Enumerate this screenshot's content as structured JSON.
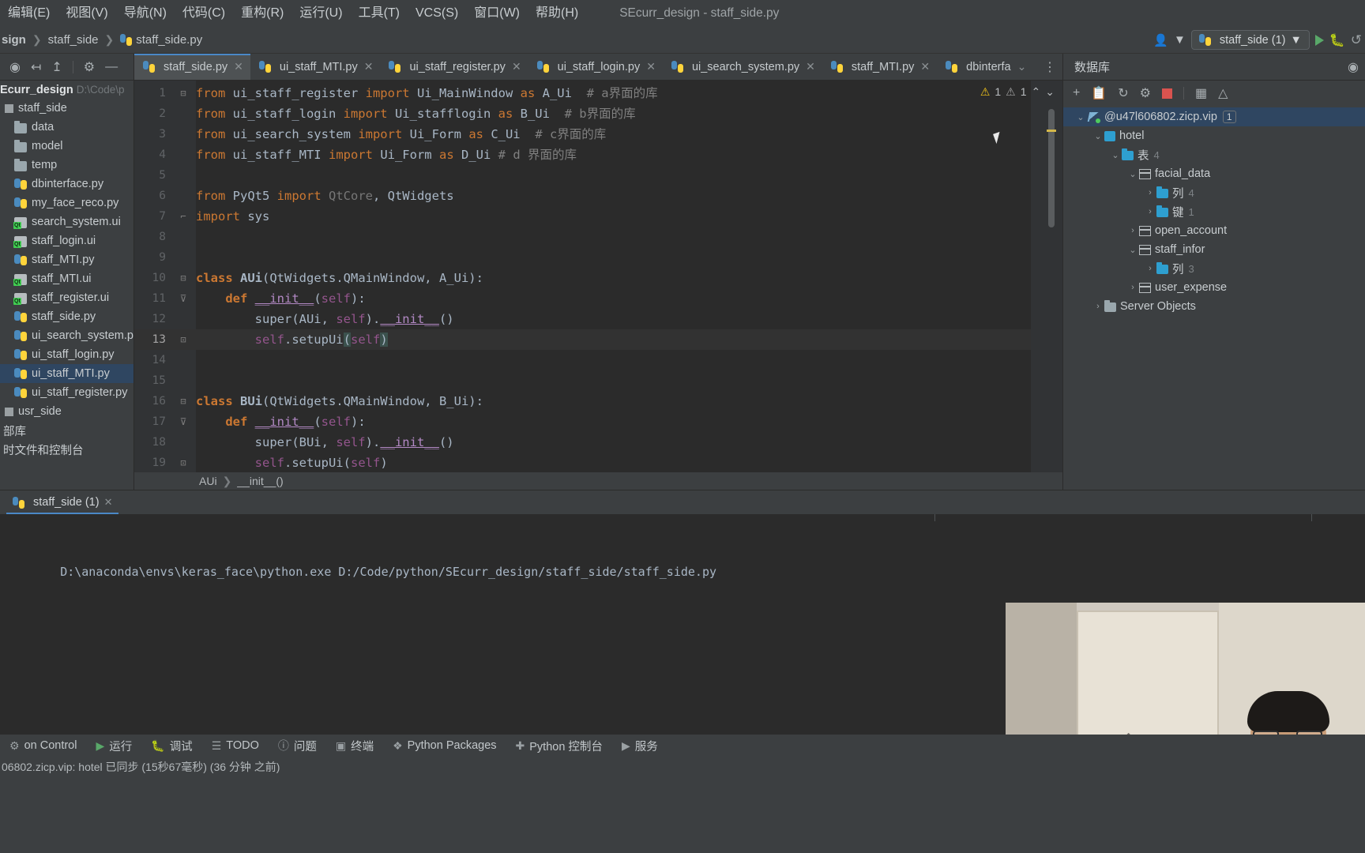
{
  "window": {
    "title": "SEcurr_design - staff_side.py"
  },
  "menubar": {
    "items": [
      {
        "label": "编辑(E)"
      },
      {
        "label": "视图(V)"
      },
      {
        "label": "导航(N)"
      },
      {
        "label": "代码(C)"
      },
      {
        "label": "重构(R)"
      },
      {
        "label": "运行(U)"
      },
      {
        "label": "工具(T)"
      },
      {
        "label": "VCS(S)"
      },
      {
        "label": "窗口(W)"
      },
      {
        "label": "帮助(H)"
      }
    ]
  },
  "navbar": {
    "breadcrumbs": [
      "sign",
      "staff_side",
      "staff_side.py"
    ],
    "run_config": "staff_side (1)",
    "run_config_caret": "▼",
    "user_caret": "▼"
  },
  "project": {
    "header_name": "Ecurr_design",
    "header_path": "D:\\Code\\p",
    "tree": [
      {
        "label": "staff_side",
        "icon": "module-icon",
        "indent": 0,
        "selected": false
      },
      {
        "label": "data",
        "icon": "folder-icon",
        "indent": 1,
        "selected": false
      },
      {
        "label": "model",
        "icon": "folder-icon",
        "indent": 1,
        "selected": false
      },
      {
        "label": "temp",
        "icon": "folder-icon",
        "indent": 1,
        "selected": false
      },
      {
        "label": "dbinterface.py",
        "icon": "python-file-icon",
        "indent": 1,
        "selected": false
      },
      {
        "label": "my_face_reco.py",
        "icon": "python-file-icon",
        "indent": 1,
        "selected": false
      },
      {
        "label": "search_system.ui",
        "icon": "qt-file-icon",
        "indent": 1,
        "selected": false
      },
      {
        "label": "staff_login.ui",
        "icon": "qt-file-icon",
        "indent": 1,
        "selected": false
      },
      {
        "label": "staff_MTI.py",
        "icon": "python-file-icon",
        "indent": 1,
        "selected": false
      },
      {
        "label": "staff_MTI.ui",
        "icon": "qt-file-icon",
        "indent": 1,
        "selected": false
      },
      {
        "label": "staff_register.ui",
        "icon": "qt-file-icon",
        "indent": 1,
        "selected": false
      },
      {
        "label": "staff_side.py",
        "icon": "python-file-icon",
        "indent": 1,
        "selected": false
      },
      {
        "label": "ui_search_system.py",
        "icon": "python-file-icon",
        "indent": 1,
        "selected": false
      },
      {
        "label": "ui_staff_login.py",
        "icon": "python-file-icon",
        "indent": 1,
        "selected": false
      },
      {
        "label": "ui_staff_MTI.py",
        "icon": "python-file-icon",
        "indent": 1,
        "selected": true
      },
      {
        "label": "ui_staff_register.py",
        "icon": "python-file-icon",
        "indent": 1,
        "selected": false
      },
      {
        "label": "usr_side",
        "icon": "module-icon",
        "indent": 0,
        "selected": false
      },
      {
        "label": "部库",
        "icon": "none",
        "indent": 0,
        "selected": false
      },
      {
        "label": "时文件和控制台",
        "icon": "none",
        "indent": 0,
        "selected": false
      }
    ]
  },
  "editor": {
    "tabs": [
      {
        "label": "staff_side.py",
        "active": true
      },
      {
        "label": "ui_staff_MTI.py",
        "active": false
      },
      {
        "label": "ui_staff_register.py",
        "active": false
      },
      {
        "label": "ui_staff_login.py",
        "active": false
      },
      {
        "label": "ui_search_system.py",
        "active": false
      },
      {
        "label": "staff_MTI.py",
        "active": false
      },
      {
        "label": "dbinterfa",
        "active": false
      }
    ],
    "inspection": {
      "warning_count": "1",
      "weak_warning_count": "1",
      "up_caret": "⌃",
      "down_caret": "⌄"
    },
    "lines": [
      {
        "n": "1",
        "fold": "⊟"
      },
      {
        "n": "2",
        "fold": ""
      },
      {
        "n": "3",
        "fold": ""
      },
      {
        "n": "4",
        "fold": ""
      },
      {
        "n": "5",
        "fold": ""
      },
      {
        "n": "6",
        "fold": ""
      },
      {
        "n": "7",
        "fold": "⌐"
      },
      {
        "n": "8",
        "fold": ""
      },
      {
        "n": "9",
        "fold": ""
      },
      {
        "n": "10",
        "fold": "⊟"
      },
      {
        "n": "11",
        "fold": "⊽"
      },
      {
        "n": "12",
        "fold": ""
      },
      {
        "n": "13",
        "fold": "⊡"
      },
      {
        "n": "14",
        "fold": ""
      },
      {
        "n": "15",
        "fold": ""
      },
      {
        "n": "16",
        "fold": "⊟"
      },
      {
        "n": "17",
        "fold": "⊽"
      },
      {
        "n": "18",
        "fold": ""
      },
      {
        "n": "19",
        "fold": "⊡"
      }
    ],
    "code_text": [
      "from ui_staff_register import Ui_MainWindow as A_Ui  # a界面的库",
      "from ui_staff_login import Ui_stafflogin as B_Ui  # b界面的库",
      "from ui_search_system import Ui_Form as C_Ui  # c界面的库",
      "from ui_staff_MTI import Ui_Form as D_Ui  # d 界面的库",
      "",
      "from PyQt5 import QtCore, QtWidgets",
      "import sys",
      "",
      "",
      "class AUi(QtWidgets.QMainWindow, A_Ui):",
      "    def __init__(self):",
      "        super(AUi, self).__init__()",
      "        self.setupUi(self)",
      "",
      "",
      "class BUi(QtWidgets.QMainWindow, B_Ui):",
      "    def __init__(self):",
      "        super(BUi, self).__init__()",
      "        self.setupUi(self)"
    ],
    "bottom_breadcrumb": [
      "AUi",
      "__init__()"
    ]
  },
  "database": {
    "title": "数据库",
    "tree": [
      {
        "label": "@u47l606802.zicp.vip",
        "icon": "connection-icon",
        "indent": 0,
        "chev": "⌄",
        "count": "",
        "selected": true,
        "tag": "1"
      },
      {
        "label": "hotel",
        "icon": "schema-icon",
        "indent": 1,
        "chev": "⌄",
        "count": "",
        "selected": false,
        "tag": ""
      },
      {
        "label": "表",
        "icon": "table-folder-icon",
        "indent": 2,
        "chev": "⌄",
        "count": "4",
        "selected": false,
        "tag": ""
      },
      {
        "label": "facial_data",
        "icon": "table-icon",
        "indent": 3,
        "chev": "⌄",
        "count": "",
        "selected": false,
        "tag": ""
      },
      {
        "label": "列",
        "icon": "table-folder-icon",
        "indent": 4,
        "chev": "›",
        "count": "4",
        "selected": false,
        "tag": ""
      },
      {
        "label": "键",
        "icon": "table-folder-icon",
        "indent": 4,
        "chev": "›",
        "count": "1",
        "selected": false,
        "tag": ""
      },
      {
        "label": "open_account",
        "icon": "table-icon",
        "indent": 3,
        "chev": "›",
        "count": "",
        "selected": false,
        "tag": ""
      },
      {
        "label": "staff_infor",
        "icon": "table-icon",
        "indent": 3,
        "chev": "⌄",
        "count": "",
        "selected": false,
        "tag": ""
      },
      {
        "label": "列",
        "icon": "table-folder-icon",
        "indent": 4,
        "chev": "›",
        "count": "3",
        "selected": false,
        "tag": ""
      },
      {
        "label": "user_expense",
        "icon": "table-icon",
        "indent": 3,
        "chev": "›",
        "count": "",
        "selected": false,
        "tag": ""
      },
      {
        "label": "Server Objects",
        "icon": "server-objects-icon",
        "indent": 1,
        "chev": "›",
        "count": "",
        "selected": false,
        "tag": ""
      }
    ]
  },
  "run": {
    "tab_label": "staff_side (1)",
    "tab_close": "✕",
    "console_output": "D:\\anaconda\\envs\\keras_face\\python.exe D:/Code/python/SEcurr_design/staff_side/staff_side.py"
  },
  "toolwindows": [
    {
      "label": "on Control",
      "icon": "version-control-icon"
    },
    {
      "label": "运行",
      "icon": "run-icon"
    },
    {
      "label": "调试",
      "icon": "debug-icon"
    },
    {
      "label": "TODO",
      "icon": "todo-icon"
    },
    {
      "label": "问题",
      "icon": "problems-icon"
    },
    {
      "label": "终端",
      "icon": "terminal-icon"
    },
    {
      "label": "Python Packages",
      "icon": "packages-icon"
    },
    {
      "label": "Python 控制台",
      "icon": "python-console-icon"
    },
    {
      "label": "服务",
      "icon": "services-icon"
    }
  ],
  "statusbar": {
    "message": "06802.zicp.vip: hotel 已同步 (15秒67毫秒) (36 分钟 之前)"
  }
}
